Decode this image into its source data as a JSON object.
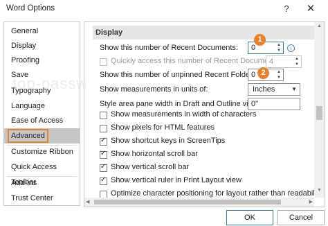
{
  "window": {
    "title": "Word Options",
    "help_label": "?",
    "close_label": "✕"
  },
  "watermark": "top-password.com",
  "sidebar": {
    "items": [
      {
        "label": "General"
      },
      {
        "label": "Display"
      },
      {
        "label": "Proofing"
      },
      {
        "label": "Save"
      },
      {
        "label": "Typography"
      },
      {
        "label": "Language"
      },
      {
        "label": "Ease of Access"
      },
      {
        "label": "Advanced"
      },
      {
        "label": "Customize Ribbon"
      },
      {
        "label": "Quick Access Toolbar"
      },
      {
        "label": "Add-ins"
      },
      {
        "label": "Trust Center"
      }
    ],
    "selected": "Advanced"
  },
  "content": {
    "section_title": "Display",
    "recent_docs": {
      "label": "Show this number of Recent Documents:",
      "value": "0",
      "info_icon": "info-icon"
    },
    "quick_access": {
      "label": "Quickly access this number of Recent Documents:",
      "value": "4",
      "checked": false,
      "disabled": true
    },
    "unpinned_folders": {
      "label": "Show this number of unpinned Recent Folders:",
      "value": "0"
    },
    "units": {
      "label": "Show measurements in units of:",
      "value": "Inches"
    },
    "style_area": {
      "label": "Style area pane width in Draft and Outline views:",
      "value": "0\""
    },
    "checkboxes": [
      {
        "label": "Show measurements in width of characters",
        "checked": false
      },
      {
        "label": "Show pixels for HTML features",
        "checked": false
      },
      {
        "label": "Show shortcut keys in ScreenTips",
        "checked": true
      },
      {
        "label": "Show horizontal scroll bar",
        "checked": true
      },
      {
        "label": "Show vertical scroll bar",
        "checked": true
      },
      {
        "label": "Show vertical ruler in Print Layout view",
        "checked": true
      },
      {
        "label": "Optimize character positioning for layout rather than readability",
        "checked": false
      }
    ],
    "callouts": [
      "1",
      "2"
    ]
  },
  "footer": {
    "ok_label": "OK",
    "cancel_label": "Cancel"
  },
  "colors": {
    "accent_orange": "#e8822a",
    "selection_gray": "#c6c6c6",
    "focus_blue": "#2b78c5"
  }
}
